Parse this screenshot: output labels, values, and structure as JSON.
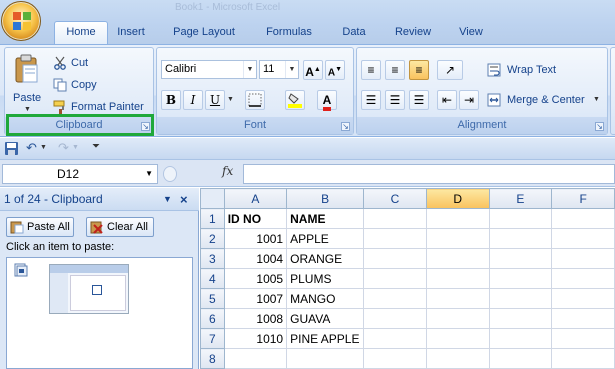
{
  "window": {
    "title_fragment": "Book1 - Microsoft Excel"
  },
  "tabs": [
    "Home",
    "Insert",
    "Page Layout",
    "Formulas",
    "Data",
    "Review",
    "View"
  ],
  "clipboard_group": {
    "paste": "Paste",
    "cut": "Cut",
    "copy": "Copy",
    "format_painter": "Format Painter",
    "label": "Clipboard"
  },
  "font_group": {
    "font_name": "Calibri",
    "font_size": "11",
    "label": "Font"
  },
  "alignment_group": {
    "wrap_text": "Wrap Text",
    "merge_center": "Merge & Center",
    "label": "Alignment"
  },
  "formula_bar": {
    "name_box": "D12",
    "fx": "fx",
    "formula": ""
  },
  "clipboard_pane": {
    "title": "1 of 24 - Clipboard",
    "paste_all": "Paste All",
    "clear_all": "Clear All",
    "hint": "Click an item to paste:"
  },
  "sheet": {
    "columns": [
      "A",
      "B",
      "C",
      "D",
      "E",
      "F"
    ],
    "selected_column": "D",
    "rows": [
      {
        "n": "1",
        "a": "ID NO",
        "b": "NAME"
      },
      {
        "n": "2",
        "a": "1001",
        "b": "APPLE"
      },
      {
        "n": "3",
        "a": "1004",
        "b": "ORANGE"
      },
      {
        "n": "4",
        "a": "1005",
        "b": "PLUMS"
      },
      {
        "n": "5",
        "a": "1007",
        "b": "MANGO"
      },
      {
        "n": "6",
        "a": "1008",
        "b": "GUAVA"
      },
      {
        "n": "7",
        "a": "1010",
        "b": "PINE APPLE"
      },
      {
        "n": "8",
        "a": "",
        "b": ""
      }
    ]
  },
  "colors": {
    "ribbon_text": "#15428b",
    "selected_header": "#f9c25e",
    "highlight_box": "#1fa83a"
  }
}
